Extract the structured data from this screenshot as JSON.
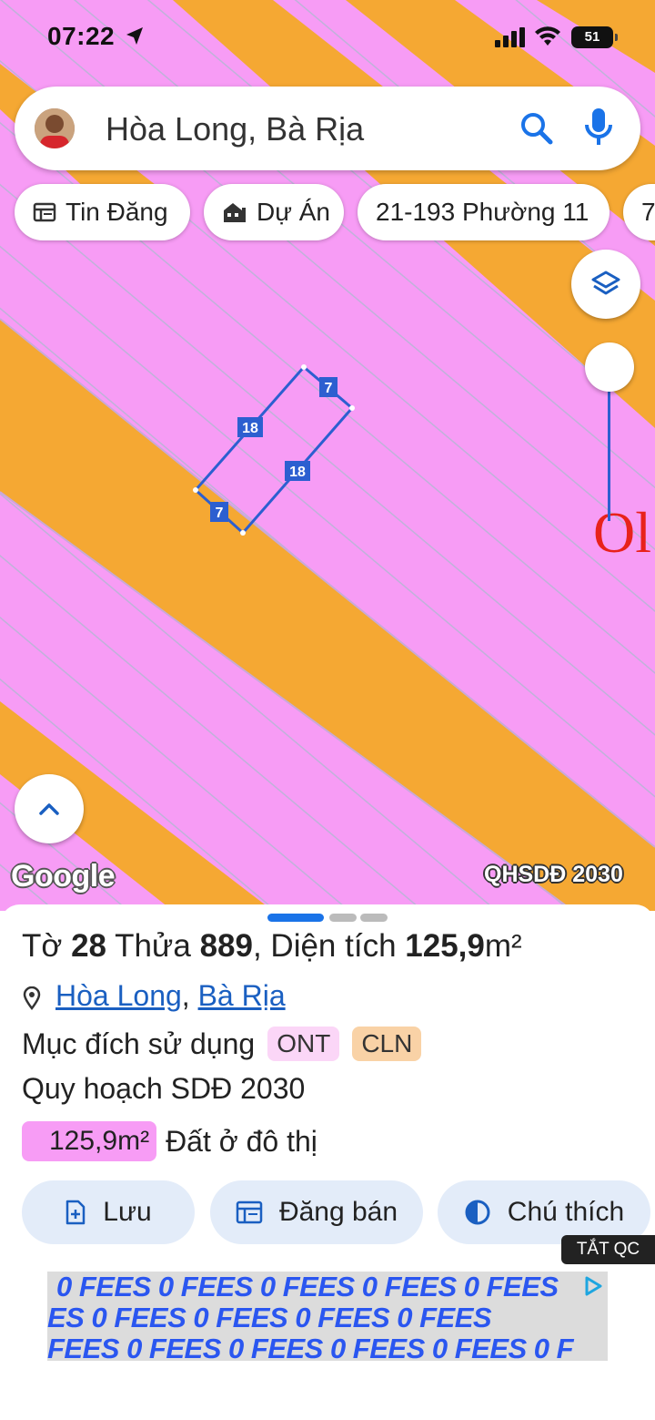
{
  "status_bar": {
    "time": "07:22",
    "battery": "51"
  },
  "search": {
    "text": "Hòa Long, Bà Rịa"
  },
  "chips": [
    {
      "label": "Tin Đăng",
      "icon": "listing-icon"
    },
    {
      "label": "Dự Án",
      "icon": "building-icon"
    },
    {
      "label": "21-193 Phường 11",
      "icon": ""
    },
    {
      "label": "7",
      "icon": ""
    }
  ],
  "map": {
    "parcel_edges": [
      "7",
      "18",
      "18",
      "7"
    ],
    "edge_label": "Ol",
    "google": "Google",
    "plan_badge": "QHSDĐ 2030",
    "colors": {
      "residential": "#f79cf5",
      "road": "#f5a833",
      "parcel_outline": "#2c5fd0"
    }
  },
  "sheet": {
    "title": {
      "sheet_prefix": "Tờ ",
      "sheet_no": "28",
      "parcel_prefix": " Thửa ",
      "parcel_no": "889",
      "area_prefix": ", Diện tích ",
      "area": "125,9",
      "unit": "m²"
    },
    "location": {
      "ward": "Hòa Long",
      "separator": ", ",
      "city": "Bà Rịa"
    },
    "purpose": {
      "label": "Mục đích sử dụng",
      "tags": [
        {
          "code": "ONT",
          "color": "#fbd6f7"
        },
        {
          "code": "CLN",
          "color": "#f9d2a6"
        }
      ]
    },
    "plan": "Quy hoạch SDĐ 2030",
    "area_row": {
      "value": "125,9m²",
      "label": "Đất ở đô thị"
    },
    "actions": [
      {
        "label": "Lưu",
        "icon": "save-icon"
      },
      {
        "label": "Đăng bán",
        "icon": "post-icon"
      },
      {
        "label": "Chú thích",
        "icon": "legend-icon"
      }
    ]
  },
  "ad": {
    "close": "TẮT QC",
    "lines": [
      "0 FEES 0 FEES 0 FEES 0 FEES 0 FEES",
      "ES 0 FEES 0 FEES 0 FEES 0 FEES",
      "FEES 0 FEES 0 FEES 0 FEES 0 FEES 0 F"
    ]
  }
}
